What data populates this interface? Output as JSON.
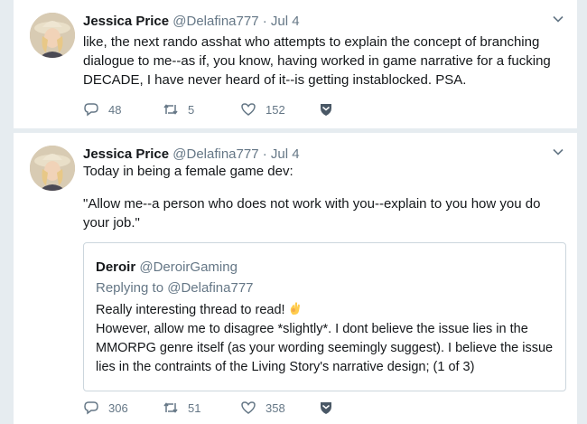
{
  "tweets": [
    {
      "author_name": "Jessica Price",
      "handle": "@Delafina777",
      "separator": "·",
      "time": "Jul 4",
      "text": "like, the next rando asshat who attempts to explain the concept of branching dialogue to me--as if, you know, having worked in game narrative for a fucking DECADE, I have never heard of it--is getting instablocked. PSA.",
      "replies": "48",
      "retweets": "5",
      "likes": "152"
    },
    {
      "author_name": "Jessica Price",
      "handle": "@Delafina777",
      "separator": "·",
      "time": "Jul 4",
      "text_line1": "Today in being a female game dev:",
      "text_line2": "\"Allow me--a person who does not work with you--explain to you how you do your job.\"",
      "replies": "306",
      "retweets": "51",
      "likes": "358",
      "quote": {
        "author_name": "Deroir",
        "handle": "@DeroirGaming",
        "replying_prefix": "Replying to",
        "replying_to": "@Delafina777",
        "text_line1": "Really interesting thread to read!",
        "emoji": "ok-hand-emoji",
        "text_line2": "However, allow me to disagree *slightly*. I dont believe the issue lies in the MMORPG genre itself (as your wording seemingly suggest). I believe the issue lies in the contraints of the Living Story's narrative design; (1 of 3)"
      }
    }
  ],
  "colors": {
    "background": "#e6ecf0",
    "card": "#ffffff",
    "text": "#14171a",
    "muted": "#657786",
    "border": "#ccd6dd",
    "dm_icon": "#657786"
  },
  "icons": [
    "reply-icon",
    "retweet-icon",
    "like-icon",
    "direct-message-icon",
    "chevron-down-icon",
    "avatar"
  ]
}
